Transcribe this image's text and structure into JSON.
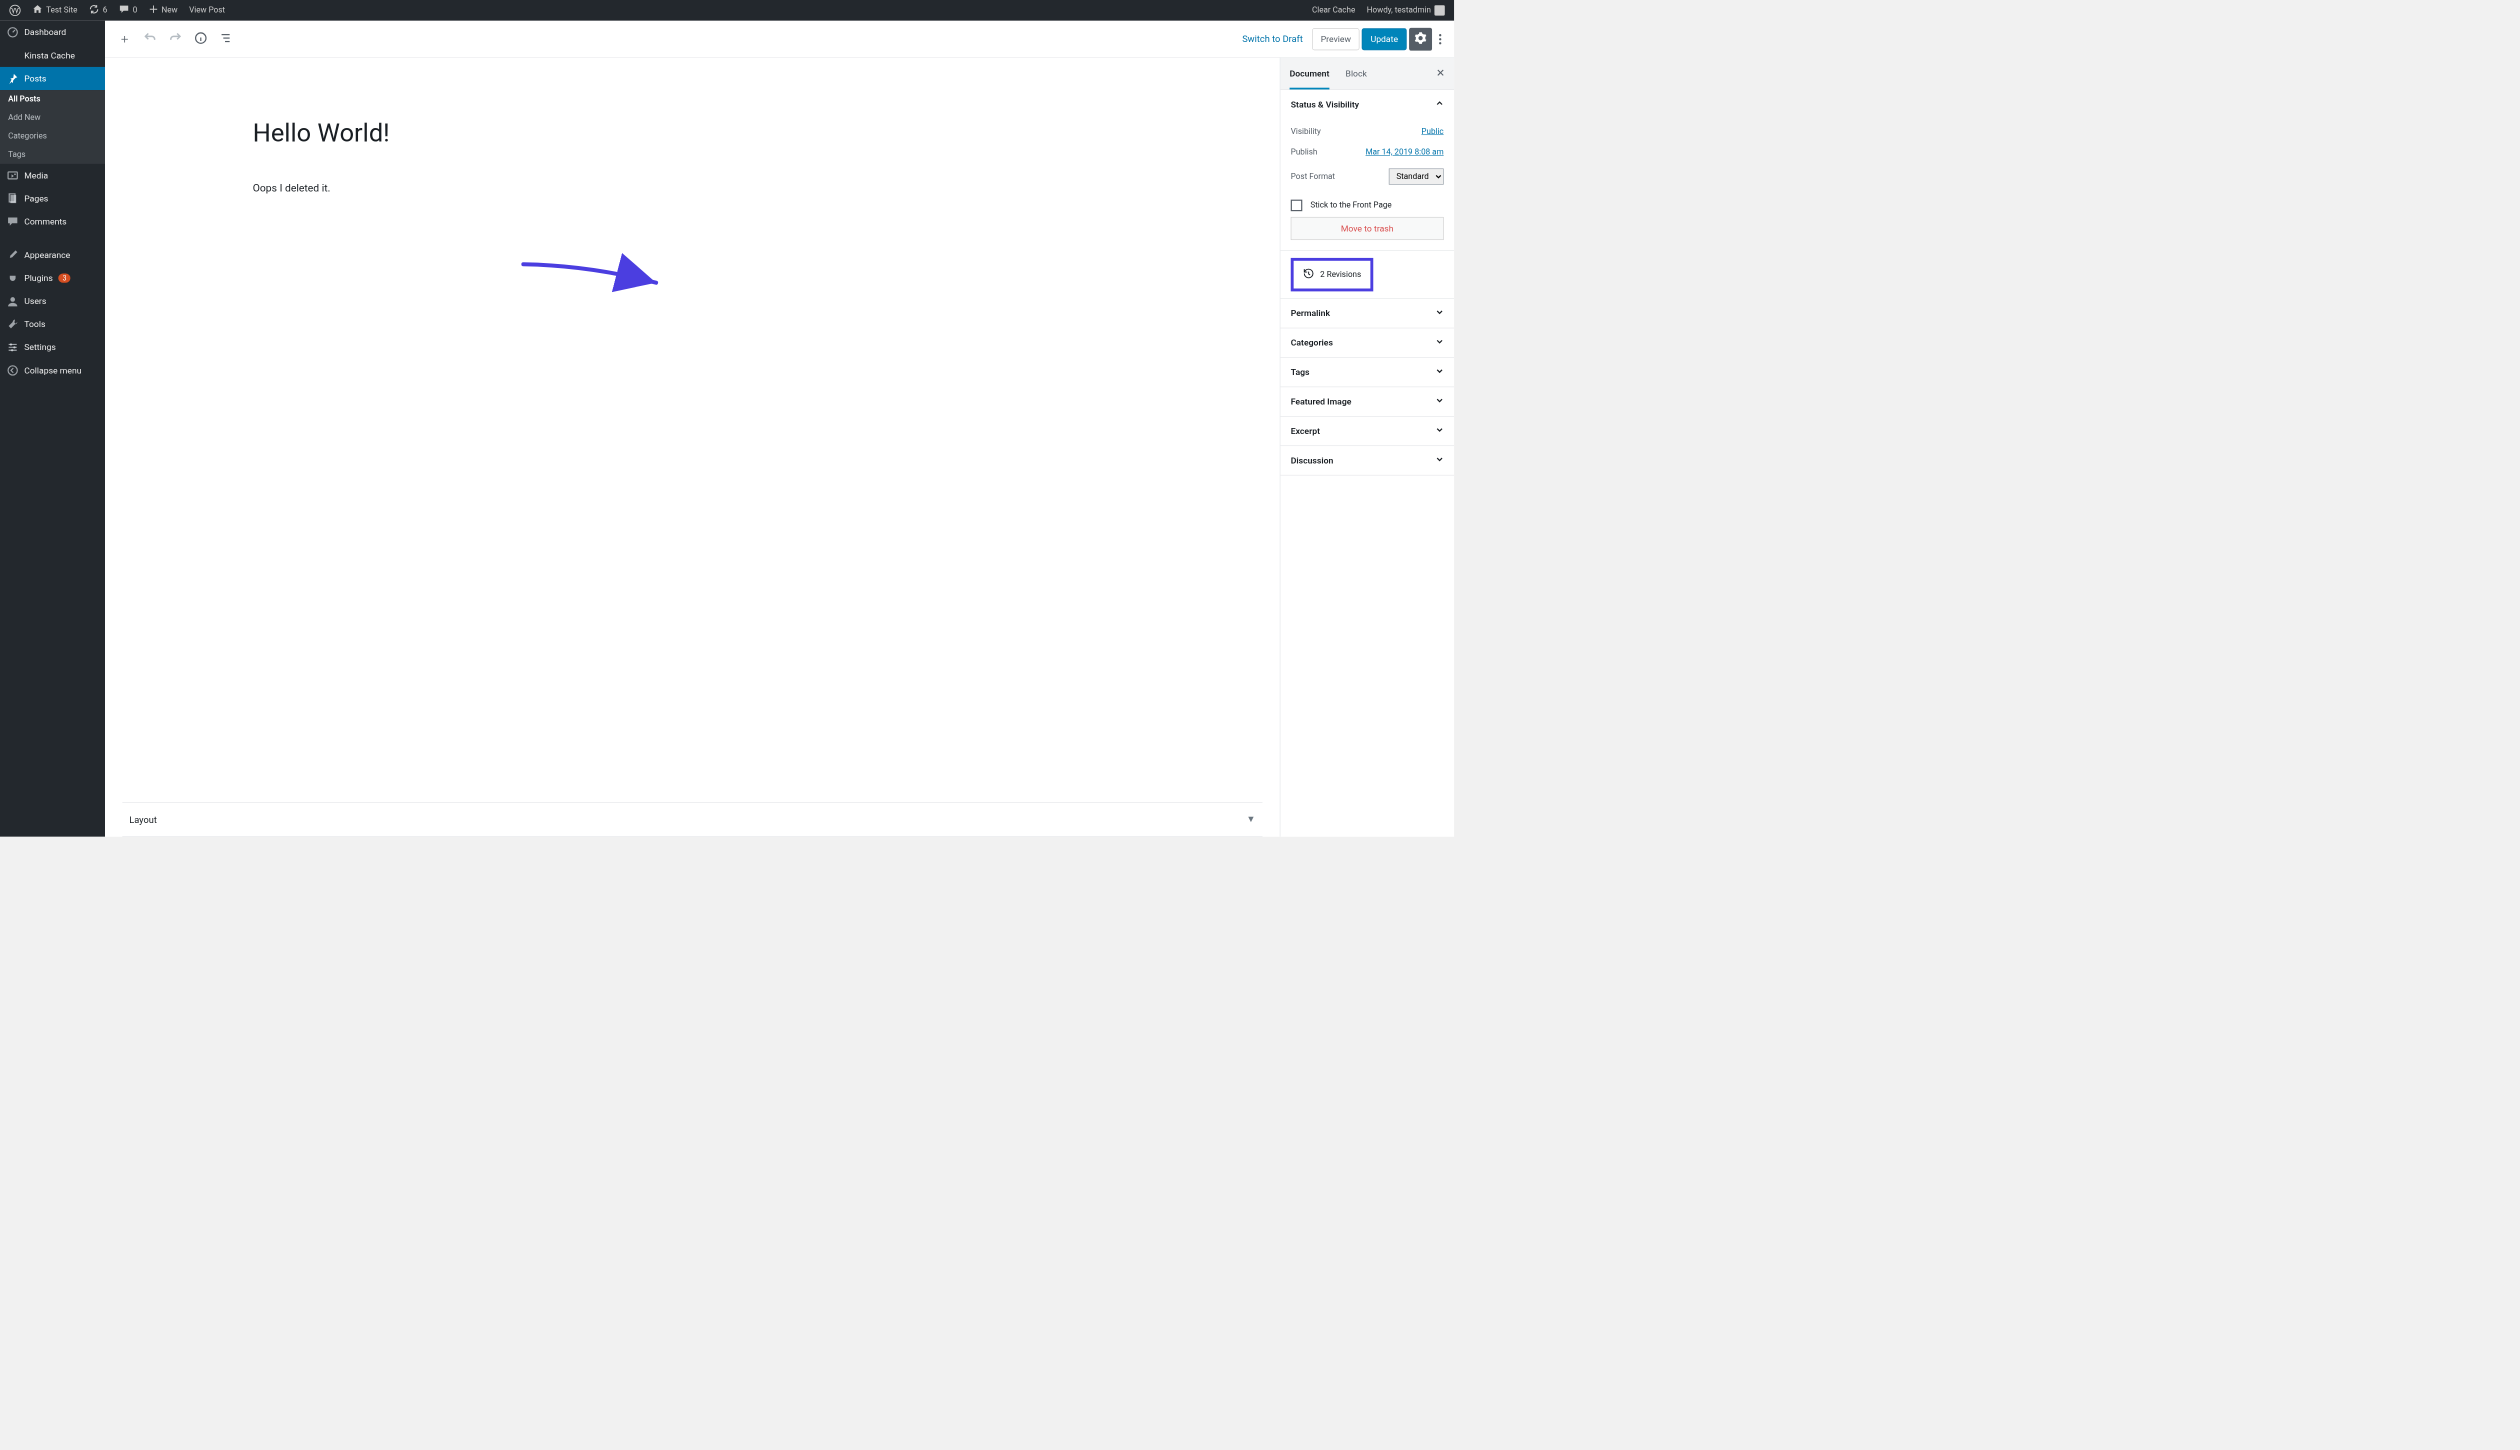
{
  "adminbar": {
    "site_name": "Test Site",
    "updates": "6",
    "comments": "0",
    "new": "New",
    "view_post": "View Post",
    "clear_cache": "Clear Cache",
    "howdy": "Howdy, testadmin"
  },
  "sidebar": {
    "dashboard": "Dashboard",
    "kinsta": "Kinsta Cache",
    "posts": "Posts",
    "submenu": {
      "all_posts": "All Posts",
      "add_new": "Add New",
      "categories": "Categories",
      "tags": "Tags"
    },
    "media": "Media",
    "pages": "Pages",
    "comments": "Comments",
    "appearance": "Appearance",
    "plugins": "Plugins",
    "plugins_count": "3",
    "users": "Users",
    "tools": "Tools",
    "settings": "Settings",
    "collapse": "Collapse menu"
  },
  "toolbar": {
    "switch_draft": "Switch to Draft",
    "preview": "Preview",
    "update": "Update"
  },
  "post": {
    "title": "Hello World!",
    "body": "Oops I deleted it.",
    "layout_label": "Layout"
  },
  "settings_panel": {
    "tab_document": "Document",
    "tab_block": "Block",
    "status_heading": "Status & Visibility",
    "visibility_label": "Visibility",
    "visibility_value": "Public",
    "publish_label": "Publish",
    "publish_value": "Mar 14, 2019 8:08 am",
    "post_format_label": "Post Format",
    "post_format_value": "Standard",
    "stick_label": "Stick to the Front Page",
    "trash": "Move to trash",
    "revisions": "2 Revisions",
    "permalink": "Permalink",
    "categories": "Categories",
    "tags": "Tags",
    "featured": "Featured Image",
    "excerpt": "Excerpt",
    "discussion": "Discussion"
  }
}
